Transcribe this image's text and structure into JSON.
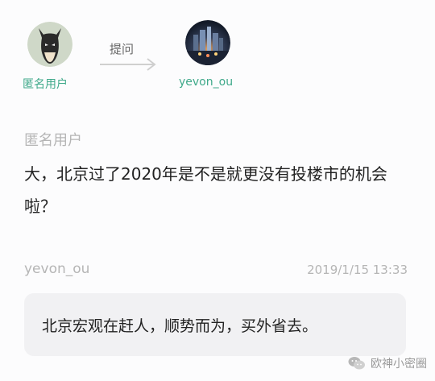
{
  "header": {
    "asker_name": "匿名用户",
    "action_label": "提问",
    "answerer_name": "yevon_ou",
    "asker_avatar_icon": "batman-mask-avatar-icon",
    "answerer_avatar_icon": "city-night-avatar-icon"
  },
  "question": {
    "asker_label": "匿名用户",
    "text": "大，北京过了2020年是不是就更没有投楼市的机会啦？"
  },
  "answer": {
    "author": "yevon_ou",
    "timestamp": "2019/1/15 13:33",
    "text": "北京宏观在赶人，顺势而为，买外省去。"
  },
  "watermark": {
    "text": "欧神小密圈",
    "icon": "wechat-icon"
  },
  "colors": {
    "accent_green": "#3fa98a",
    "muted_text": "#b5b5b5",
    "bubble_bg": "#f1f1f3"
  }
}
